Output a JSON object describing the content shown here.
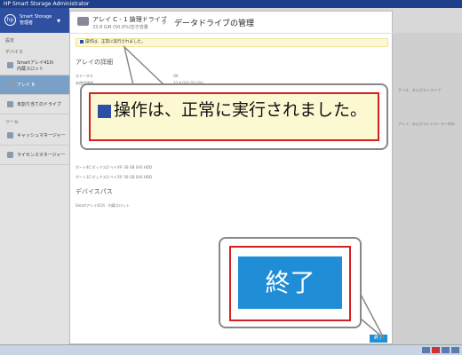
{
  "window_title": "HP Smart Storage Administrator",
  "app_header": {
    "brand_line1": "Smart Storage",
    "brand_line2": "管理者",
    "logo": "hp"
  },
  "sidebar": {
    "section_settings": "設定",
    "section_devices": "デバイス",
    "items": [
      {
        "label": "Smartアレイ410i",
        "sub": "内蔵スロット"
      },
      {
        "label": "アレイ B"
      },
      {
        "label": "未割り当てのドライブ"
      }
    ],
    "section_tools": "ツール",
    "tool_items": [
      {
        "label": "キャッシュマネージャー"
      },
      {
        "label": "ライセンスマネージャー"
      }
    ]
  },
  "right_panel": {
    "line1": "サイズ、およびストライプ",
    "line2": "アレイ、およびコントローラー内の"
  },
  "modal": {
    "header_title": "アレイ C - 1 論理ドライブ",
    "header_sub": "33.8 GiB (50.0%)空き容量",
    "page_title": "データドライブの管理",
    "notice": "操作は、正常に実行されました。",
    "section_details": "アレイの詳細",
    "rows": [
      {
        "key": "ステータス",
        "value": "OK"
      },
      {
        "key": "未使用領域",
        "value": "33.8 GiB (50.0%)"
      }
    ],
    "drive_rows": [
      "ポート4C:ボックス2:ベイ4平 36 GB SAS HDD",
      "ポート1C:ボックス2:ベイ3平 36 GB SAS HDD"
    ],
    "section_paths": "デバイスパス",
    "path_value": "Smartアレイ410i - 内蔵スロット",
    "finish_label": "終了"
  },
  "callout_notice": "操作は、正常に実行されました。",
  "callout_finish": "終了",
  "colors": {
    "accent_blue": "#1f8ed6",
    "header_blue": "#2f4fa1",
    "highlight_red": "#d42020",
    "notice_bg": "#fcf8d2"
  }
}
